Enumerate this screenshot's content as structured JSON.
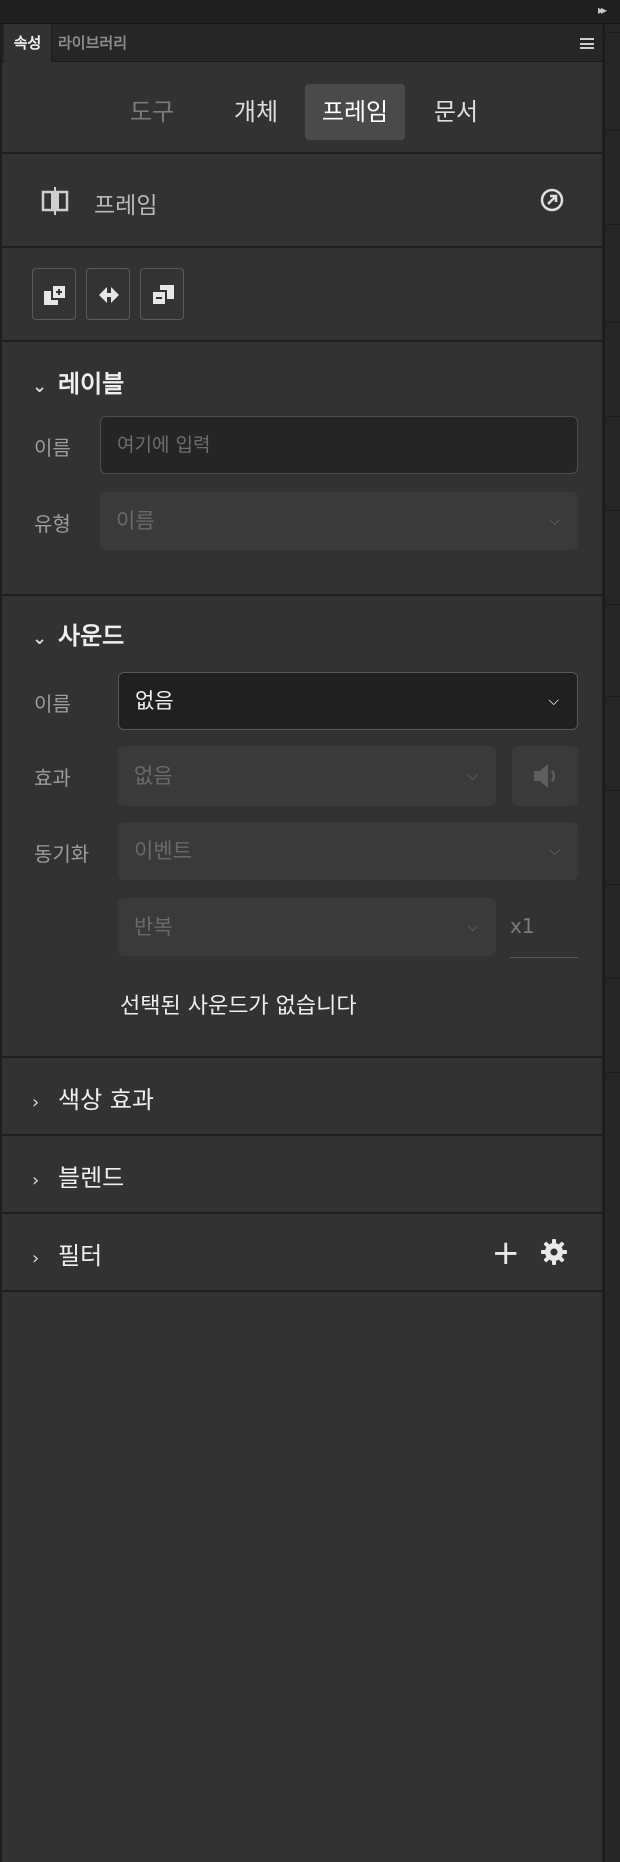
{
  "panel_tabs": [
    {
      "label": "속성",
      "active": true
    },
    {
      "label": "라이브러리",
      "active": false
    }
  ],
  "segments": [
    {
      "label": "도구",
      "state": "disabled"
    },
    {
      "label": "개체",
      "state": "normal"
    },
    {
      "label": "프레임",
      "state": "selected"
    },
    {
      "label": "문서",
      "state": "normal"
    }
  ],
  "frame_section": {
    "title": "프레임",
    "icon": "frame-icon",
    "action_icon": "goto-arrow-circle-icon"
  },
  "frame_buttons": [
    "bring-forward-icon",
    "swap-icon",
    "send-backward-icon"
  ],
  "label_section": {
    "title": "레이블",
    "name_label": "이름",
    "name_placeholder": "여기에 입력",
    "type_label": "유형",
    "type_value": "이름"
  },
  "sound_section": {
    "title": "사운드",
    "name_label": "이름",
    "name_value": "없음",
    "effect_label": "효과",
    "effect_value": "없음",
    "sync_label": "동기화",
    "sync_value": "이벤트",
    "repeat_value": "반복",
    "repeat_count": "x1",
    "status": "선택된 사운드가 없습니다"
  },
  "collapsed_sections": [
    {
      "title": "색상 효과"
    },
    {
      "title": "블렌드"
    },
    {
      "title": "필터"
    }
  ],
  "colors": {
    "panel_bg": "#323232",
    "selected_tab_bg": "#4a4a4a",
    "divider": "#1e1e1e"
  }
}
